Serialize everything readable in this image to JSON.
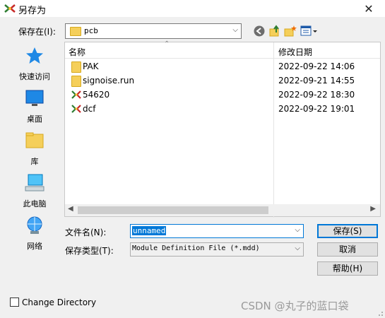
{
  "window": {
    "title": "另存为",
    "close_glyph": "✕"
  },
  "save_in": {
    "label": "保存在(I):",
    "value": "pcb"
  },
  "places": [
    {
      "label": "快速访问",
      "icon": "star-icon"
    },
    {
      "label": "桌面",
      "icon": "desktop-icon"
    },
    {
      "label": "库",
      "icon": "library-icon"
    },
    {
      "label": "此电脑",
      "icon": "computer-icon"
    },
    {
      "label": "网络",
      "icon": "network-icon"
    }
  ],
  "columns": {
    "name": "名称",
    "date": "修改日期"
  },
  "files": [
    {
      "name": "PAK",
      "date": "2022-09-22 14:06",
      "icon": "folder-icon"
    },
    {
      "name": "signoise.run",
      "date": "2022-09-21 14:55",
      "icon": "folder-icon"
    },
    {
      "name": "54620",
      "date": "2022-09-22 18:30",
      "icon": "app-file-icon"
    },
    {
      "name": "dcf",
      "date": "2022-09-22 19:01",
      "icon": "app-file-icon"
    }
  ],
  "form": {
    "filename_label": "文件名(N):",
    "filename_value": "unnamed",
    "filetype_label": "保存类型(T):",
    "filetype_value": "Module Definition File (*.mdd)"
  },
  "buttons": {
    "save": "保存(S)",
    "cancel": "取消",
    "help": "帮助(H)"
  },
  "change_directory": {
    "label": "Change Directory",
    "checked": false
  },
  "watermark": "CSDN @丸子的蓝口袋",
  "colors": {
    "accent": "#0078d7",
    "folder": "#f5cf5a"
  }
}
